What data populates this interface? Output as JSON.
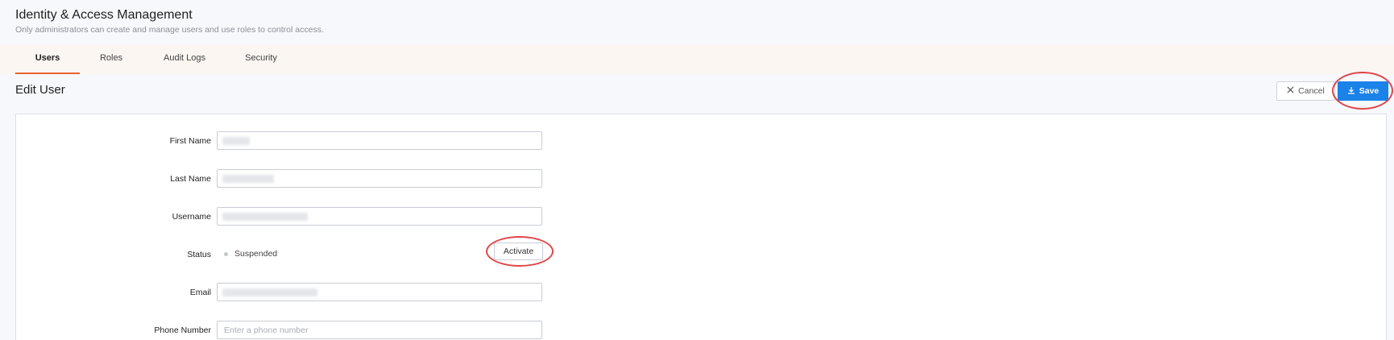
{
  "header": {
    "title": "Identity & Access Management",
    "subtitle": "Only administrators can create and manage users and use roles to control access."
  },
  "tabs": [
    {
      "label": "Users",
      "active": true
    },
    {
      "label": "Roles",
      "active": false
    },
    {
      "label": "Audit Logs",
      "active": false
    },
    {
      "label": "Security",
      "active": false
    }
  ],
  "section": {
    "title": "Edit User"
  },
  "actions": {
    "cancel_label": "Cancel",
    "save_label": "Save"
  },
  "form": {
    "first_name_label": "First Name",
    "last_name_label": "Last Name",
    "username_label": "Username",
    "status_label": "Status",
    "status_value": "Suspended",
    "activate_label": "Activate",
    "email_label": "Email",
    "phone_label": "Phone Number",
    "phone_placeholder": "Enter a phone number"
  },
  "colors": {
    "accent": "#e8632d",
    "primary": "#1a82e8",
    "highlight": "#e0454a"
  }
}
